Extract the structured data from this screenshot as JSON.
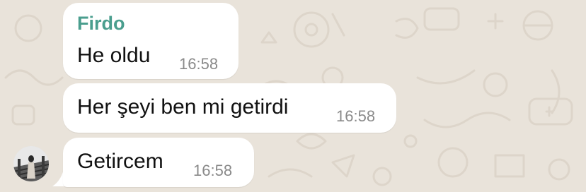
{
  "chat": {
    "messages": [
      {
        "sender": "Firdo",
        "text": "He oldu",
        "time": "16:58"
      },
      {
        "text": "Her şeyi ben mi getirdi",
        "time": "16:58"
      },
      {
        "text": "Getircem",
        "time": "16:58"
      }
    ]
  },
  "colors": {
    "background": "#e9e3da",
    "bubble": "#ffffff",
    "sender": "#4a9e8e",
    "time": "#8a8a8a"
  },
  "icons": [
    "contact-avatar-icon"
  ]
}
